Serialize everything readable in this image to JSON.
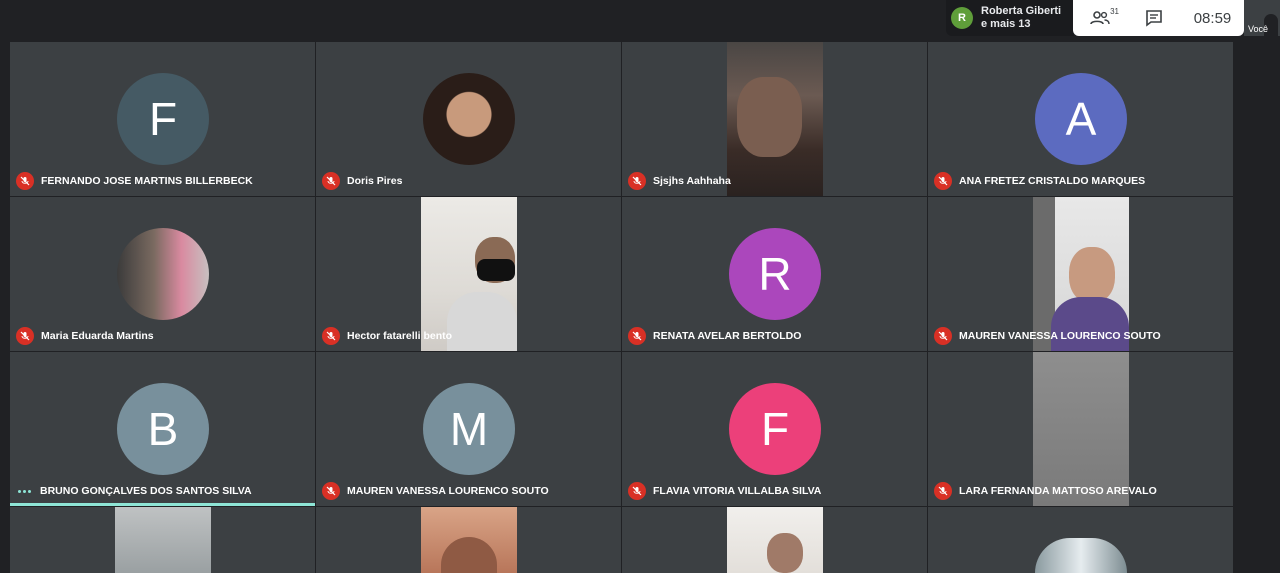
{
  "topbar": {
    "presenter_initial": "R",
    "presenter_line1": "Roberta Giberti",
    "presenter_line2": "e mais 13",
    "participants_count": "31",
    "clock": "08:59",
    "self_label": "Você"
  },
  "tiles": [
    {
      "name": "FERNANDO JOSE MARTINS BILLERBECK",
      "initial": "F",
      "color": "#455a64"
    },
    {
      "name": "Doris Pires"
    },
    {
      "name": "Sjsjhs Aahhaha"
    },
    {
      "name": "ANA FRETEZ CRISTALDO MARQUES",
      "initial": "A",
      "color": "#5c6bc0"
    },
    {
      "name": "Maria Eduarda Martins"
    },
    {
      "name": "Hector fatarelli bento"
    },
    {
      "name": "RENATA AVELAR BERTOLDO",
      "initial": "R",
      "color": "#ab47bc"
    },
    {
      "name": "MAUREN VANESSA LOURENCO SOUTO"
    },
    {
      "name": "BRUNO GONÇALVES DOS SANTOS SILVA",
      "initial": "B",
      "color": "#78909c"
    },
    {
      "name": "MAUREN VANESSA LOURENCO SOUTO",
      "initial": "M",
      "color": "#78909c"
    },
    {
      "name": "FLAVIA VITORIA VILLALBA SILVA",
      "initial": "F",
      "color": "#ec407a"
    },
    {
      "name": "LARA FERNANDA MATTOSO AREVALO"
    }
  ]
}
